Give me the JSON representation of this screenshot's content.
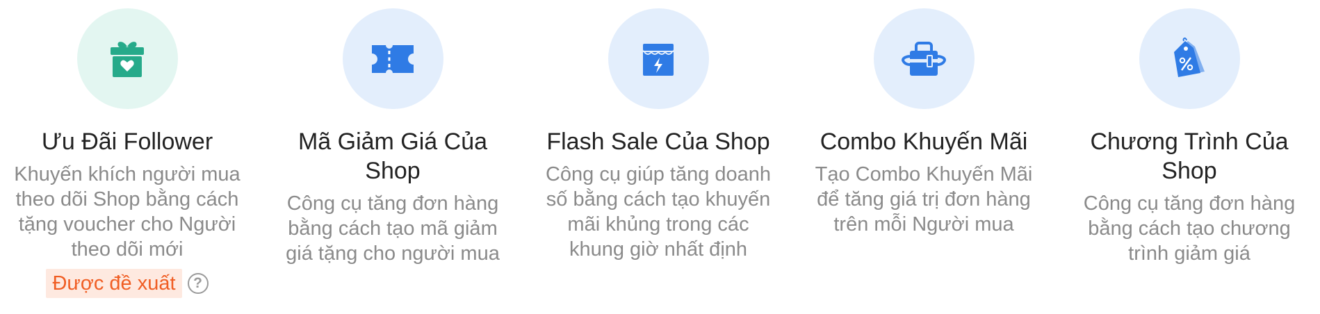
{
  "cards": [
    {
      "title": "Ưu Đãi Follower",
      "description": "Khuyến khích người mua theo dõi Shop bằng cách tặng voucher cho Người theo dõi mới",
      "badge": "Được đề xuất",
      "help": "?",
      "icon": "gift-icon"
    },
    {
      "title": "Mã Giảm Giá Của Shop",
      "description": "Công cụ tăng đơn hàng bằng cách tạo mã giảm giá tặng cho người mua",
      "icon": "voucher-ticket-icon"
    },
    {
      "title": "Flash Sale Của Shop",
      "description": "Công cụ giúp tăng doanh số bằng cách tạo khuyến mãi khủng trong các khung giờ nhất định",
      "icon": "flash-store-icon"
    },
    {
      "title": "Combo Khuyến Mãi",
      "description": "Tạo Combo Khuyến Mãi để tăng giá trị đơn hàng trên mỗi Người mua",
      "icon": "bundle-bag-icon"
    },
    {
      "title": "Chương Trình Của Shop",
      "description": "Công cụ tăng đơn hàng bằng cách tạo chương trình giảm giá",
      "icon": "discount-tag-icon"
    }
  ],
  "colors": {
    "teal_icon": "#26aa8a",
    "blue_icon": "#2f7be5",
    "teal_bg": "#e3f6f1",
    "blue_bg": "#e3eefc",
    "badge_text": "#f05d23",
    "badge_bg": "#fee9e0"
  }
}
